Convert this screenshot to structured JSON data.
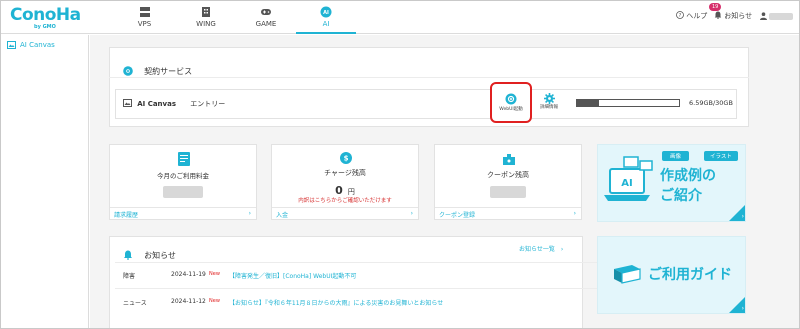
{
  "topnav": {
    "logo": "ConoHa",
    "logo_sub": "by GMO",
    "tabs": [
      {
        "label": "VPS",
        "icon": "server-icon"
      },
      {
        "label": "WING",
        "icon": "building-icon"
      },
      {
        "label": "GAME",
        "icon": "gamepad-icon"
      },
      {
        "label": "AI",
        "icon": "ai-icon"
      }
    ],
    "help_label": "ヘルプ",
    "notice_label": "お知らせ",
    "notice_badge": "19"
  },
  "sidebar": {
    "items": [
      {
        "label": "AI Canvas",
        "icon": "canvas-icon"
      }
    ]
  },
  "service": {
    "section_title": "契約サービス",
    "name": "AI Canvas",
    "plan": "エントリー",
    "webui_label": "WebUI起動",
    "detail_label": "詳細情報",
    "storage_text": "6.59GB/30GB",
    "storage_used_fraction": 0.22
  },
  "cards": {
    "usage": {
      "title": "今月のご利用料金",
      "footer": "請求履歴"
    },
    "charge": {
      "title": "チャージ残高",
      "amount": "0",
      "unit": "円",
      "note": "内訳はこちらからご確認いただけます",
      "footer": "入金"
    },
    "coupon": {
      "title": "クーポン残高",
      "footer": "クーポン登録"
    }
  },
  "promo": {
    "tag1": "画像",
    "tag2": "イラスト",
    "line1": "作成例の",
    "line2": "ご紹介",
    "guide": "ご利用ガイド"
  },
  "news": {
    "title": "お知らせ",
    "more_label": "お知らせ一覧",
    "items": [
      {
        "category": "障害",
        "date": "2024-11-19",
        "badge": "New",
        "text": "【障害発生／復旧】[ConoHa] WebUI起動不可"
      },
      {
        "category": "ニュース",
        "date": "2024-11-12",
        "badge": "New",
        "text": "【お知らせ】『令和６年11月８日からの大雨』による災害のお見舞いとお知らせ"
      }
    ]
  },
  "colors": {
    "accent": "#1fb3d3",
    "highlight": "#e02020",
    "badge": "#d62e6b"
  }
}
